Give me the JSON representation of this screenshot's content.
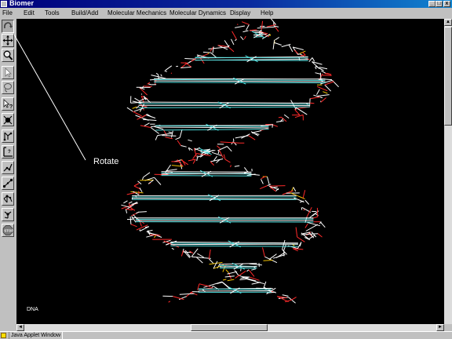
{
  "window": {
    "title": "Biomer"
  },
  "menu": {
    "items": [
      {
        "label": "File"
      },
      {
        "label": "Edit"
      },
      {
        "label": "Tools"
      },
      {
        "label": "Build/Add"
      },
      {
        "label": "Molecular Mechanics"
      },
      {
        "label": "Molecular Dynamics"
      },
      {
        "label": "Display"
      },
      {
        "label": "Help"
      }
    ]
  },
  "toolbar": {
    "tools": [
      {
        "icon": "rotate-icon",
        "active": true
      },
      {
        "icon": "translate-icon"
      },
      {
        "icon": "zoom-icon"
      },
      {
        "icon": "select-pointer-icon"
      },
      {
        "icon": "lasso-select-icon"
      },
      {
        "icon": "query-atom-icon"
      },
      {
        "icon": "add-atom-icon"
      },
      {
        "icon": "bond-length-icon"
      },
      {
        "icon": "bond-angle-icon"
      },
      {
        "icon": "dihedral-icon"
      },
      {
        "icon": "measure-distance-icon"
      },
      {
        "icon": "molecule-fragment-icon"
      },
      {
        "icon": "settings-molecule-icon"
      },
      {
        "icon": "stop-icon"
      }
    ]
  },
  "canvas": {
    "molecule_label": "DNA",
    "background": "#000000",
    "colors": {
      "backbone": "#ffffff",
      "oxygen": "#ff2a2a",
      "phosphorus": "#f0c000",
      "base": "#4adcdc"
    }
  },
  "callout": {
    "label": "Rotate"
  },
  "statusbar": {
    "text": "Java Applet Window"
  }
}
